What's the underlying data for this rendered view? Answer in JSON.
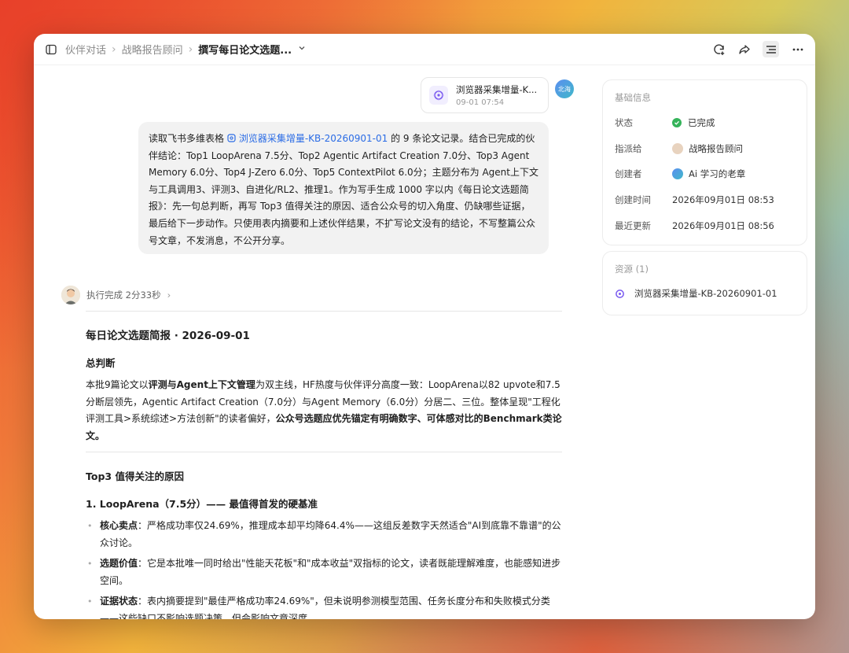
{
  "breadcrumb": {
    "items": [
      "伙伴对话",
      "战略报告顾问",
      "撰写每日论文选题..."
    ]
  },
  "attachment": {
    "name": "浏览器采集增量-K...",
    "time": "09-01 07:54"
  },
  "user": {
    "avatar_text": "北海"
  },
  "message": {
    "prefix": "读取飞书多维表格 ",
    "link": "浏览器采集增量-KB-20260901-01",
    "body": " 的 9 条论文记录。结合已完成的伙伴结论：Top1 LoopArena 7.5分、Top2 Agentic Artifact Creation 7.0分、Top3 Agent Memory 6.0分、Top4 J-Zero 6.0分、Top5 ContextPilot 6.0分；主题分布为 Agent上下文与工具调用3、评测3、自进化/RL2、推理1。作为写手生成 1000 字以内《每日论文选题简报》：先一句总判断，再写 Top3 值得关注的原因、适合公众号的切入角度、仍缺哪些证据，最后给下一步动作。只使用表内摘要和上述伙伴结果，不扩写论文没有的结论，不写整篇公众号文章，不发消息，不公开分享。"
  },
  "exec": {
    "label": "执行完成 2分33秒"
  },
  "doc": {
    "title": "每日论文选题简报 · 2026-09-01",
    "section1": "总判断",
    "p1_a": "本批9篇论文以",
    "p1_b": "评测与Agent上下文管理",
    "p1_c": "为双主线，HF热度与伙伴评分高度一致：LoopArena以82 upvote和7.5分断层领先，Agentic Artifact Creation（7.0分）与Agent Memory（6.0分）分居二、三位。整体呈现\"工程化评测工具>系统综述>方法创新\"的读者偏好，",
    "p1_d": "公众号选题应优先锚定有明确数字、可体感对比的Benchmark类论文。",
    "section2": "Top3 值得关注的原因",
    "item1_title": "1. LoopArena（7.5分）—— 最值得首发的硬基准",
    "bullets": [
      {
        "k": "核心卖点",
        "v": "：严格成功率仅24.69%，推理成本却平均降64.4%——这组反差数字天然适合\"AI到底靠不靠谱\"的公众讨论。"
      },
      {
        "k": "选题价值",
        "v": "：它是本批唯一同时给出\"性能天花板\"和\"成本收益\"双指标的论文，读者既能理解难度，也能感知进步空间。"
      },
      {
        "k": "证据状态",
        "v": "：表内摘要提到\"最佳严格成功率24.69%\"，但未说明参测模型范围、任务长度分布和失败模式分类——这些缺口不影响选题决策，但会影响文章深度。"
      }
    ]
  },
  "side": {
    "info_title": "基础信息",
    "rows": [
      {
        "k": "状态",
        "v": "已完成"
      },
      {
        "k": "指派给",
        "v": "战略报告顾问"
      },
      {
        "k": "创建者",
        "v": "Ai 学习的老章"
      },
      {
        "k": "创建时间",
        "v": "2026年09月01日 08:53"
      },
      {
        "k": "最近更新",
        "v": "2026年09月01日 08:56"
      }
    ],
    "res_title": "资源 (1)",
    "res_item": "浏览器采集增量-KB-20260901-01"
  },
  "colors": {
    "link": "#2b6ce5",
    "status_ok": "#35b35a"
  }
}
